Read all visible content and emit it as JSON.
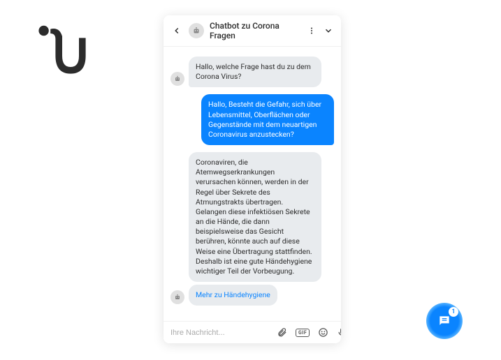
{
  "header": {
    "title": "Chatbot zu Corona Fragen"
  },
  "messages": {
    "m0": "Hallo, welche Frage hast du zu dem Corona Virus?",
    "m1": "Hallo, Besteht die Gefahr, sich über Lebensmittel, Oberflächen oder Gegenstände mit dem neuartigen Coronavirus anzustecken?",
    "m2": "Coronaviren, die Atemwegserkrankungen verursachen können, werden in der Regel über Sekrete des Atmungstrakts übertragen. Gelangen diese infektiösen Sekrete an die Hände, die dann beispielsweise das Gesicht berühren, könnte auch auf diese Weise eine Übertragung stattfinden. Deshalb ist eine gute Händehygiene wichtiger Teil der Vorbeugung.",
    "m3": "Mehr zu Händehygiene"
  },
  "input": {
    "placeholder": "Ihre Nachricht..."
  },
  "fab": {
    "badge": "1"
  }
}
